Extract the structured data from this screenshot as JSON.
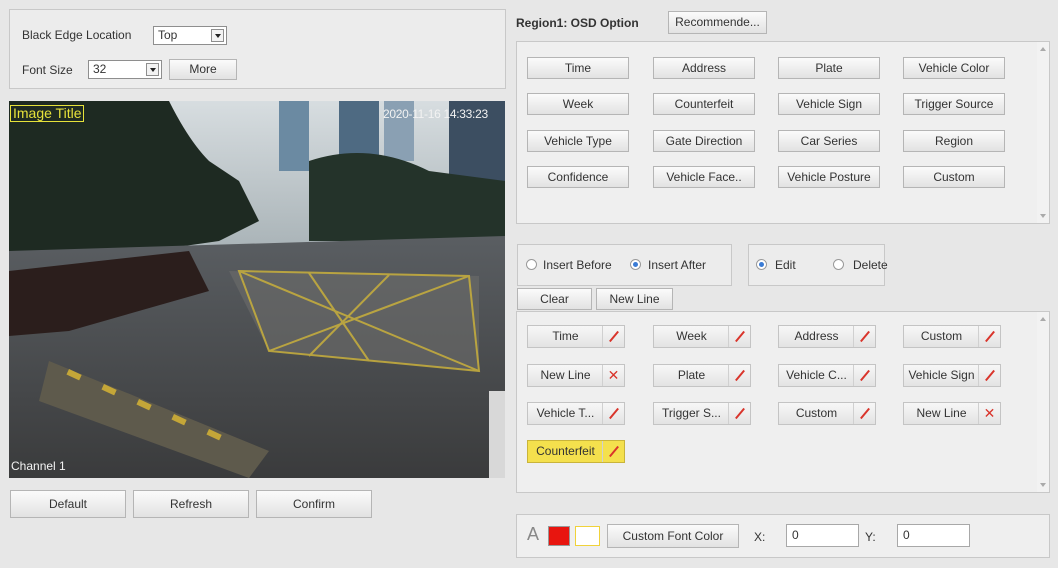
{
  "settings": {
    "black_edge_label": "Black Edge Location",
    "black_edge_value": "Top",
    "font_size_label": "Font Size",
    "font_size_value": "32",
    "more_label": "More"
  },
  "video": {
    "title_overlay": "Image Title",
    "timestamp": "2020-11-16 14:33:23",
    "channel": "Channel 1"
  },
  "bottom_buttons": {
    "default": "Default",
    "refresh": "Refresh",
    "confirm": "Confirm"
  },
  "osd": {
    "region_label": "Region1:  OSD Option",
    "recommend_label": "Recommende...",
    "options": [
      "Time",
      "Address",
      "Plate",
      "Vehicle Color",
      "Week",
      "Counterfeit",
      "Vehicle Sign",
      "Trigger Source",
      "Vehicle Type",
      "Gate Direction",
      "Car Series",
      "Region",
      "Confidence",
      "Vehicle Face..",
      "Vehicle Posture",
      "Custom"
    ]
  },
  "insert": {
    "before": "Insert Before",
    "after": "Insert After",
    "selected": "after"
  },
  "mode": {
    "edit": "Edit",
    "delete": "Delete",
    "selected": "edit"
  },
  "actions": {
    "clear": "Clear",
    "new_line": "New Line"
  },
  "selected_items": [
    {
      "label": "Time",
      "icon": "pencil-icon"
    },
    {
      "label": "Week",
      "icon": "pencil-icon"
    },
    {
      "label": "Address",
      "icon": "pencil-icon"
    },
    {
      "label": "Custom",
      "icon": "pencil-icon"
    },
    {
      "label": "New Line",
      "icon": "close-icon"
    },
    {
      "label": "Plate",
      "icon": "pencil-icon"
    },
    {
      "label": "Vehicle C...",
      "icon": "pencil-icon"
    },
    {
      "label": "Vehicle Sign",
      "icon": "pencil-icon"
    },
    {
      "label": "Vehicle T...",
      "icon": "pencil-icon"
    },
    {
      "label": "Trigger S...",
      "icon": "pencil-icon"
    },
    {
      "label": "Custom",
      "icon": "pencil-icon"
    },
    {
      "label": "New Line",
      "icon": "close-icon"
    },
    {
      "label": "Counterfeit",
      "icon": "pencil-icon",
      "highlighted": true
    }
  ],
  "font_color": {
    "font_icon": "A",
    "colors": [
      "#e8150f",
      "#ffffff"
    ],
    "custom_label": "Custom Font Color",
    "x_label": "X:",
    "x_value": "0",
    "y_label": "Y:",
    "y_value": "0"
  },
  "colors": {
    "highlight": "#f4e04d",
    "overlay_title": "#e6e23a",
    "accent_red": "#d9342b"
  }
}
